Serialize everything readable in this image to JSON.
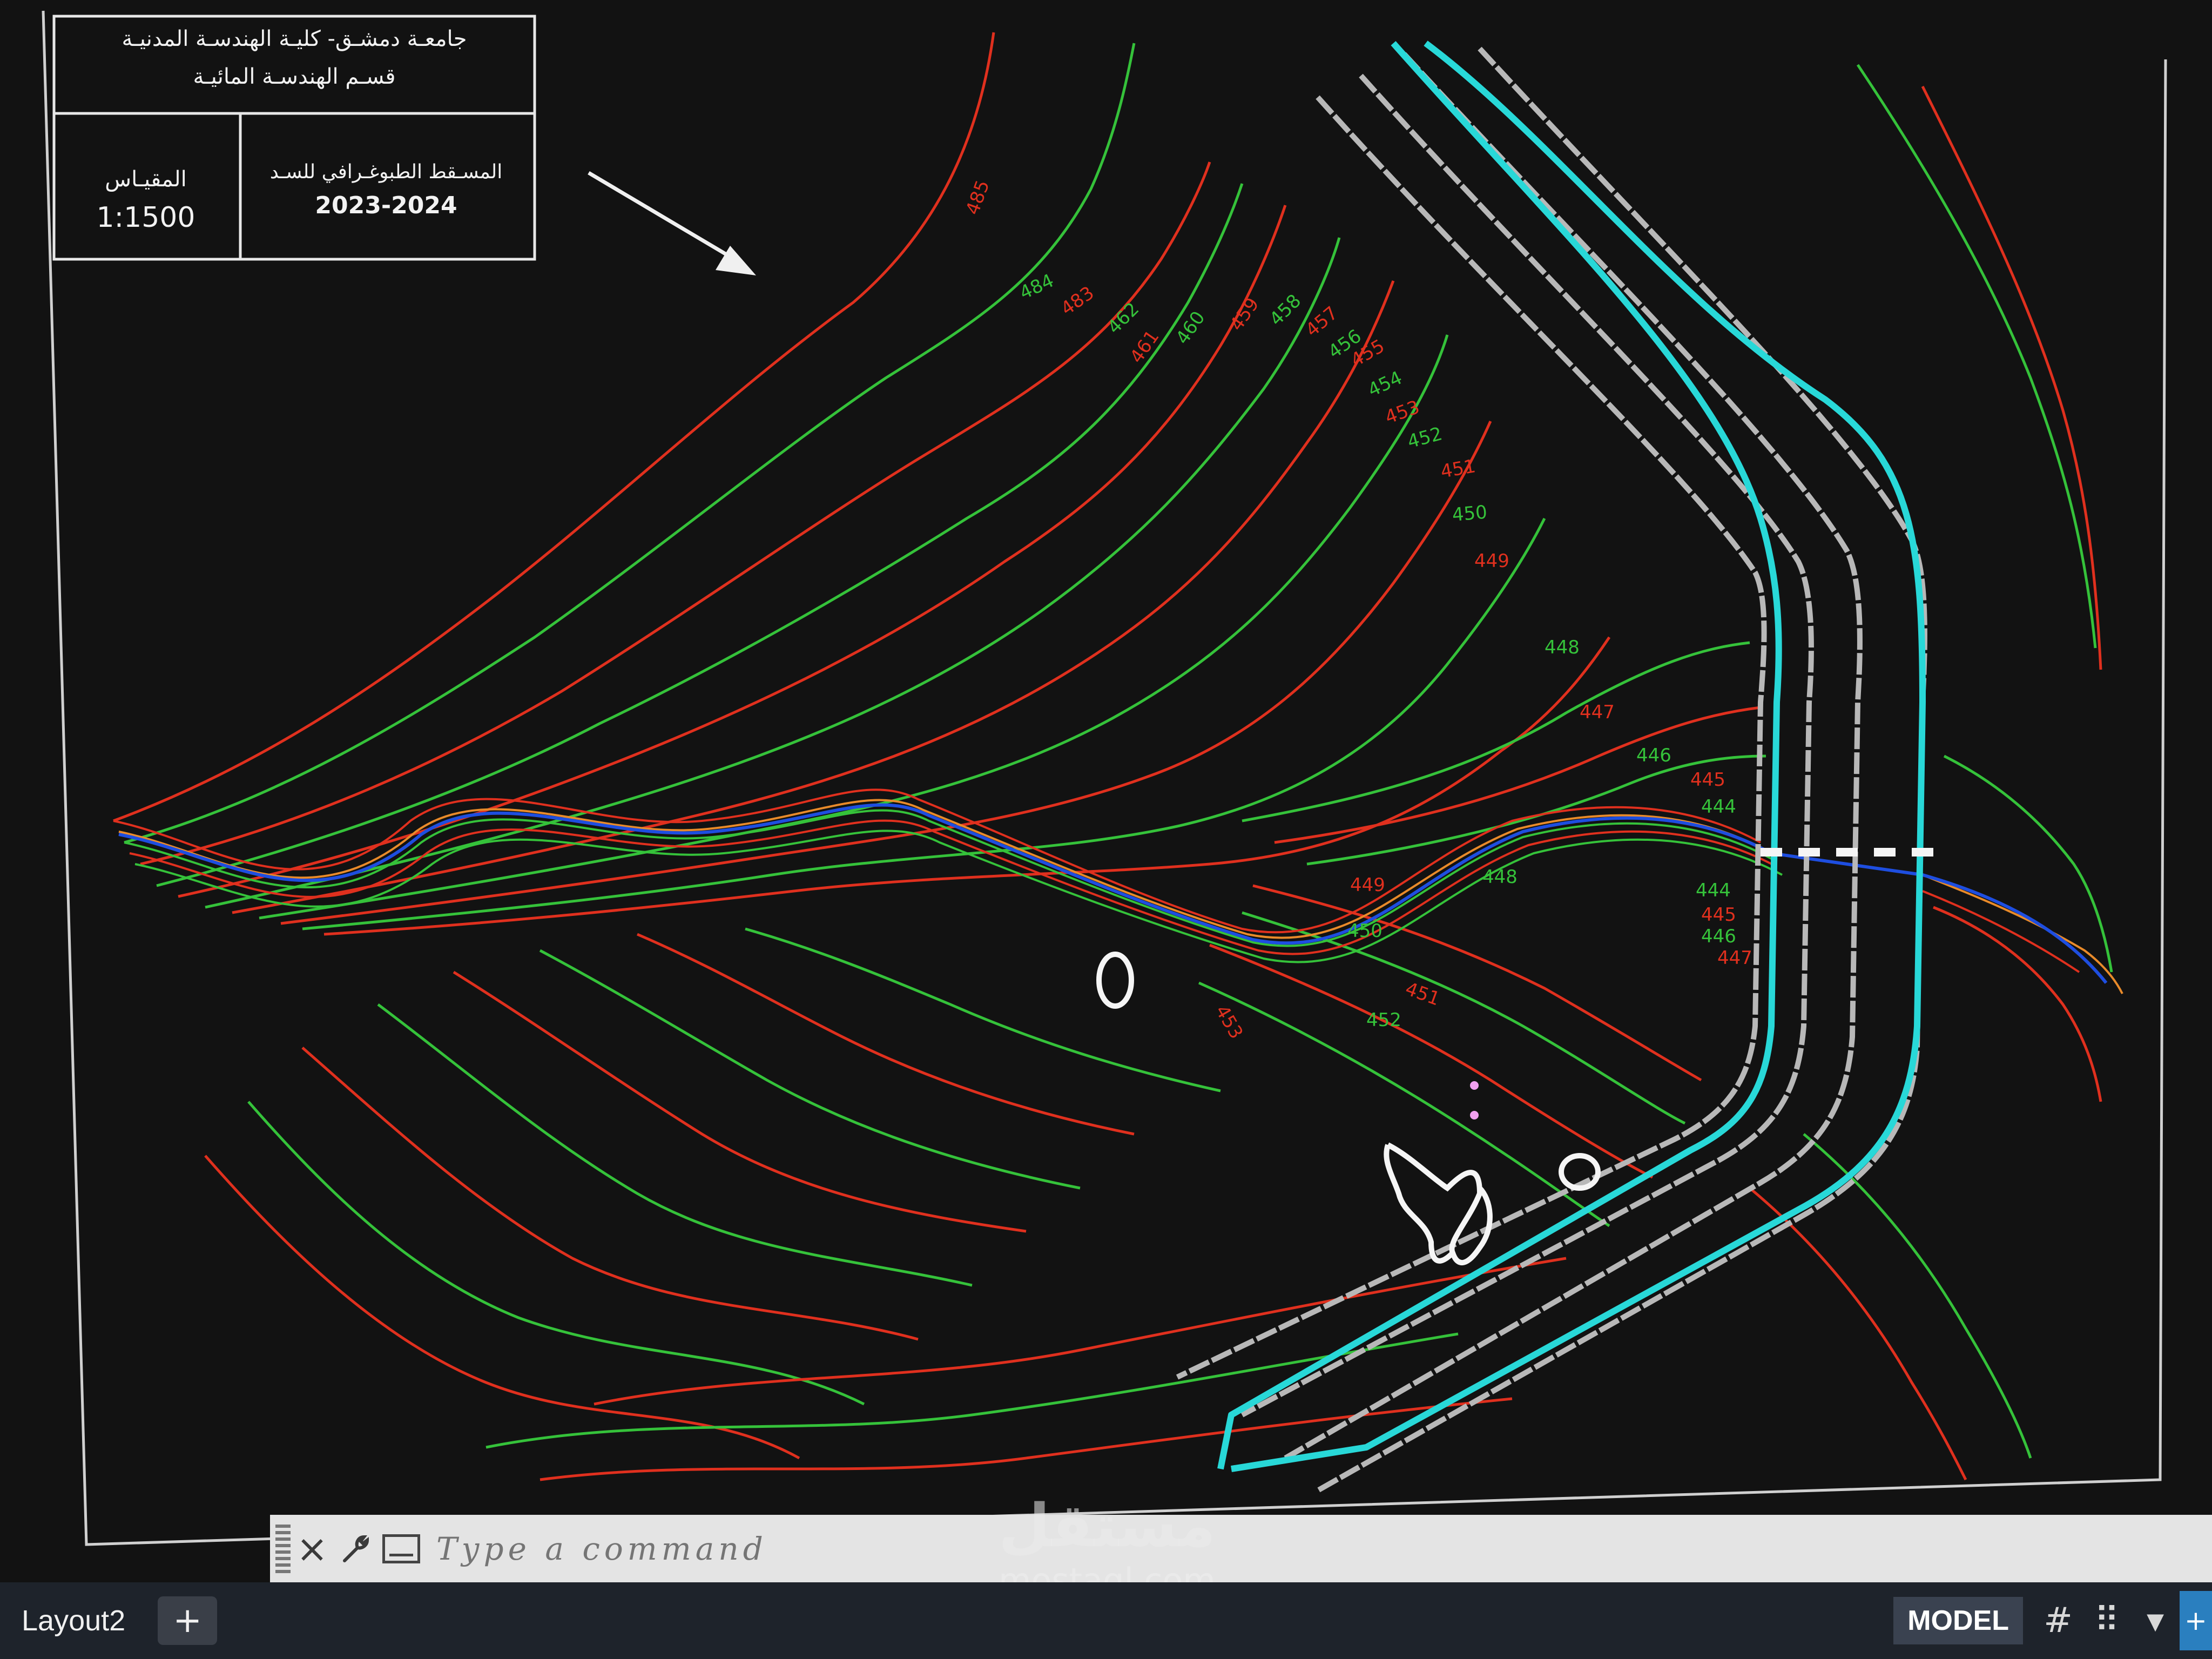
{
  "title_block": {
    "university_line": "جامعـة دمشـق- كليـة الهندسـة المدنيـة",
    "department_line": "قسـم الهندسـة المائيـة",
    "scale_label": "المقيـاس",
    "scale_value": "1:1500",
    "drawing_title": "المسـقط الطبوغـرافي للسـد",
    "academic_year": "2023-2024"
  },
  "contour_labels": {
    "upper_left": [
      "485",
      "484",
      "483",
      "462",
      "461",
      "460",
      "459",
      "458",
      "457",
      "456",
      "455",
      "454",
      "453",
      "452",
      "451",
      "450",
      "449"
    ],
    "right": [
      "448",
      "447",
      "446",
      "445",
      "444"
    ],
    "lower": [
      "449",
      "448",
      "450",
      "451",
      "452",
      "453"
    ],
    "right_cluster": [
      "444",
      "445",
      "446",
      "447"
    ]
  },
  "colors": {
    "background": "#121212",
    "contour_red": "#e0301e",
    "contour_green": "#35c23a",
    "stream_blue": "#1e4ee0",
    "dam_cyan": "#28d8d8",
    "dam_grey": "#b8b8b8",
    "sheet_border": "#d0d0d0"
  },
  "command_line": {
    "placeholder": "Type a command",
    "close_icon": "×",
    "customize_icon": "wrench-icon",
    "prompt_icon": "command-prompt-icon"
  },
  "status_bar": {
    "layout_tab": "Layout2",
    "add_tab_label": "+",
    "model_label": "MODEL",
    "grid_icon": "#",
    "snap_icon": "⠿",
    "dropdown_icon": "▾"
  },
  "watermark": {
    "logo_text": "مستقل",
    "url": "mostaql.com"
  }
}
